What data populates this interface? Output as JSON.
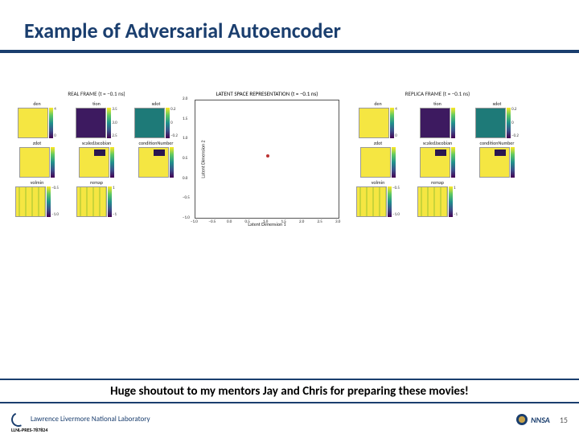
{
  "title": "Example of Adversarial Autoencoder",
  "shoutout": "Huge shoutout to my mentors Jay and Chris for preparing these movies!",
  "footer": {
    "lab": "Lawrence Livermore National Laboratory",
    "pres_id": "LLNL-PRES-787824",
    "nnsa": "NNSA",
    "pagenum": "15"
  },
  "left_panel": {
    "title": "REAL FRAME (t = −0.1 ns)",
    "cells": [
      {
        "label": "den",
        "cls": "yellow",
        "cbar": [
          "4",
          "",
          "0"
        ]
      },
      {
        "label": "tion",
        "cls": "purple",
        "cbar": [
          "3.5",
          "3.0",
          "2.5"
        ]
      },
      {
        "label": "xdot",
        "cls": "teal",
        "cbar": [
          "0.2",
          "0",
          "−0.2"
        ]
      },
      {
        "label": "zdot",
        "cls": "yellow",
        "cbar": [
          "",
          "",
          ""
        ]
      },
      {
        "label": "scaledJacobian",
        "cls": "blotch",
        "cbar": [
          "",
          "",
          ""
        ]
      },
      {
        "label": "conditionNumber",
        "cls": "blotch",
        "cbar": [
          "",
          "",
          ""
        ]
      },
      {
        "label": "volmin",
        "cls": "striped",
        "cbar": [
          "−0.5",
          "",
          "−1.0"
        ]
      },
      {
        "label": "remap",
        "cls": "striped",
        "cbar": [
          "1",
          "",
          "−1"
        ]
      },
      {
        "label": "",
        "cls": "",
        "cbar": []
      }
    ]
  },
  "right_panel": {
    "title": "REPLICA FRAME (t = −0.1 ns)",
    "cells": [
      {
        "label": "den",
        "cls": "yellow",
        "cbar": [
          "4",
          "",
          "0"
        ]
      },
      {
        "label": "tion",
        "cls": "purple",
        "cbar": [
          "",
          "",
          ""
        ]
      },
      {
        "label": "xdot",
        "cls": "teal",
        "cbar": [
          "0.2",
          "0",
          "−0.2"
        ]
      },
      {
        "label": "zdot",
        "cls": "yellow",
        "cbar": [
          "",
          "",
          ""
        ]
      },
      {
        "label": "scaledJacobian",
        "cls": "blotch",
        "cbar": [
          "",
          "",
          ""
        ]
      },
      {
        "label": "conditionNumber",
        "cls": "blotch",
        "cbar": [
          "",
          "",
          ""
        ]
      },
      {
        "label": "volmin",
        "cls": "striped",
        "cbar": [
          "−0.5",
          "",
          "−1.0"
        ]
      },
      {
        "label": "remap",
        "cls": "striped",
        "cbar": [
          "1",
          "",
          "−1"
        ]
      },
      {
        "label": "",
        "cls": "",
        "cbar": []
      }
    ]
  },
  "chart_data": {
    "type": "scatter",
    "title": "LATENT SPACE REPRESENTATION (t = −0.1 ns)",
    "xlabel": "Latent Dimension 1",
    "ylabel": "Latent Dimension 2",
    "xlim": [
      -1.0,
      3.0
    ],
    "ylim": [
      -1.0,
      2.0
    ],
    "xticks": [
      "−1.0",
      "−0.5",
      "0.0",
      "0.5",
      "1.0",
      "1.5",
      "2.0",
      "2.5",
      "3.0"
    ],
    "yticks": [
      "−1.0",
      "−0.5",
      "0.0",
      "0.5",
      "1.0",
      "1.5",
      "2.0"
    ],
    "points": [
      {
        "x": 1.0,
        "y": 0.6
      }
    ]
  }
}
